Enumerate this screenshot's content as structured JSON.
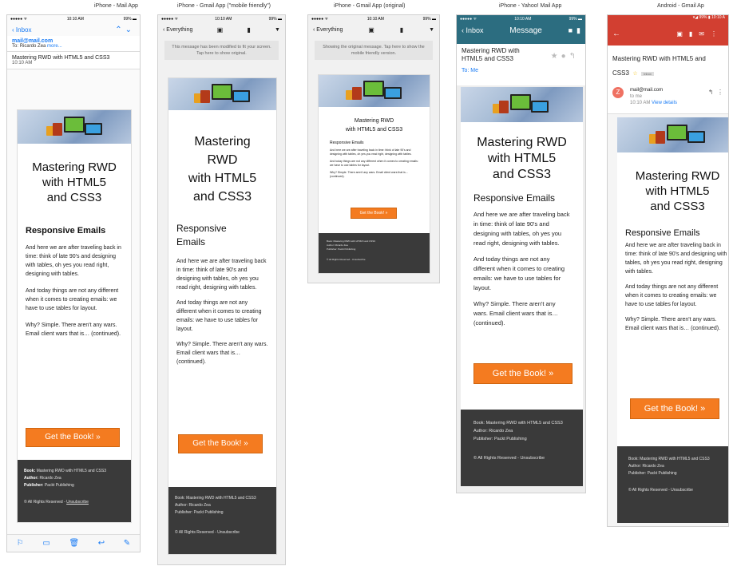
{
  "captions": {
    "mail": "iPhone - Mail App",
    "gmail_friendly": "iPhone - Gmail App (\"mobile friendly\")",
    "gmail_original": "iPhone - Gmail App (original)",
    "yahoo": "iPhone - Yahoo! Mail App",
    "android": "Android - Gmail Ap"
  },
  "status": {
    "carrier": "●●●●● ᯤ",
    "time": "10:10 AM",
    "battery": "99%",
    "android_battery": "99%",
    "android_time": "10:10 A"
  },
  "mail_app": {
    "back": "Inbox",
    "from": "mail@mail.com",
    "to_prefix": "To:",
    "to_name": "Ricardo Zea",
    "more": "more...",
    "subject": "Mastering RWD with HTML5 and CSS3",
    "time": "10:10 AM"
  },
  "gmail_friendly": {
    "back": "Everything",
    "notice": "This message has been modified to fit your screen. Tap here to show original."
  },
  "gmail_original": {
    "back": "Everything",
    "notice": "Showing the original message. Tap here to show the mobile friendly version."
  },
  "yahoo": {
    "back": "Inbox",
    "title": "Message",
    "subject": "Mastering RWD with HTML5 and CSS3",
    "to": "To: Me"
  },
  "android": {
    "subject": "Mastering RWD with HTML5 and CSS3",
    "label": "Inbox",
    "avatar": "Z",
    "from": "mail@mail.com",
    "to": "to me",
    "time": "10:10 AM",
    "view_details": "View details"
  },
  "email": {
    "title": "Mastering RWD with HTML5 and CSS3",
    "title_l1": "Mastering RWD",
    "title_l2": "with HTML5",
    "title_l3": "and CSS3",
    "friendly_t1": "Mastering",
    "friendly_t2": "RWD",
    "friendly_t3": "with HTML5",
    "friendly_t4": "and CSS3",
    "subtitle": "Responsive Emails",
    "p1": "And here we are after traveling back in time: think of late 90's and designing with tables, oh yes you read right, designing with tables.",
    "p2": "And today things are not any different when it comes to creating emails: we have to use tables for layout.",
    "p3": "Why? Simple. There aren't any wars. Email client wars that is… (continued).",
    "cta": "Get the Book! »",
    "f_book_label": "Book:",
    "f_book": "Mastering RWD with HTML5 and CSS3",
    "f_author_label": "Author:",
    "f_author": "Ricardo Zea",
    "f_publisher_label": "Publisher:",
    "f_publisher": "Packt Publishing",
    "f_rights": "© All Rights Reserved -",
    "f_unsub": "Unsubscribe",
    "f_full_1": "Book: Mastering RWD with HTML5 and CSS3",
    "f_full_2": "Author: Ricardo Zea",
    "f_full_3": "Publisher: Packt Publishing",
    "f_full_4": "© All Rights Reserved - Unsubscribe"
  },
  "colors": {
    "ios_blue": "#1a7cf5",
    "yahoo_bar": "#2c6d80",
    "android_red": "#d23f31",
    "cta_orange": "#f47b20",
    "footer_dark": "#3a3a3a"
  }
}
